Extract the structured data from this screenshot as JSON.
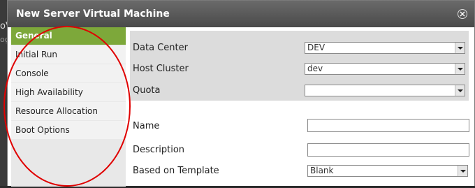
{
  "background": {
    "text1": "oV",
    "text2": "og"
  },
  "dialog": {
    "title": "New Server Virtual Machine",
    "close_icon": "close-icon"
  },
  "sidebar": {
    "items": [
      {
        "label": "General",
        "active": true
      },
      {
        "label": "Initial Run",
        "active": false
      },
      {
        "label": "Console",
        "active": false
      },
      {
        "label": "High Availability",
        "active": false
      },
      {
        "label": "Resource Allocation",
        "active": false
      },
      {
        "label": "Boot Options",
        "active": false
      }
    ]
  },
  "form": {
    "data_center": {
      "label": "Data Center",
      "value": "DEV"
    },
    "host_cluster": {
      "label": "Host Cluster",
      "value": "dev"
    },
    "quota": {
      "label": "Quota",
      "value": ""
    },
    "name": {
      "label": "Name",
      "value": ""
    },
    "description": {
      "label": "Description",
      "value": ""
    },
    "based_on_template": {
      "label": "Based on Template",
      "value": "Blank"
    }
  },
  "colors": {
    "accent_active": "#7da83a",
    "annotation_ring": "#e00000",
    "titlebar": "#4a4a4a"
  }
}
